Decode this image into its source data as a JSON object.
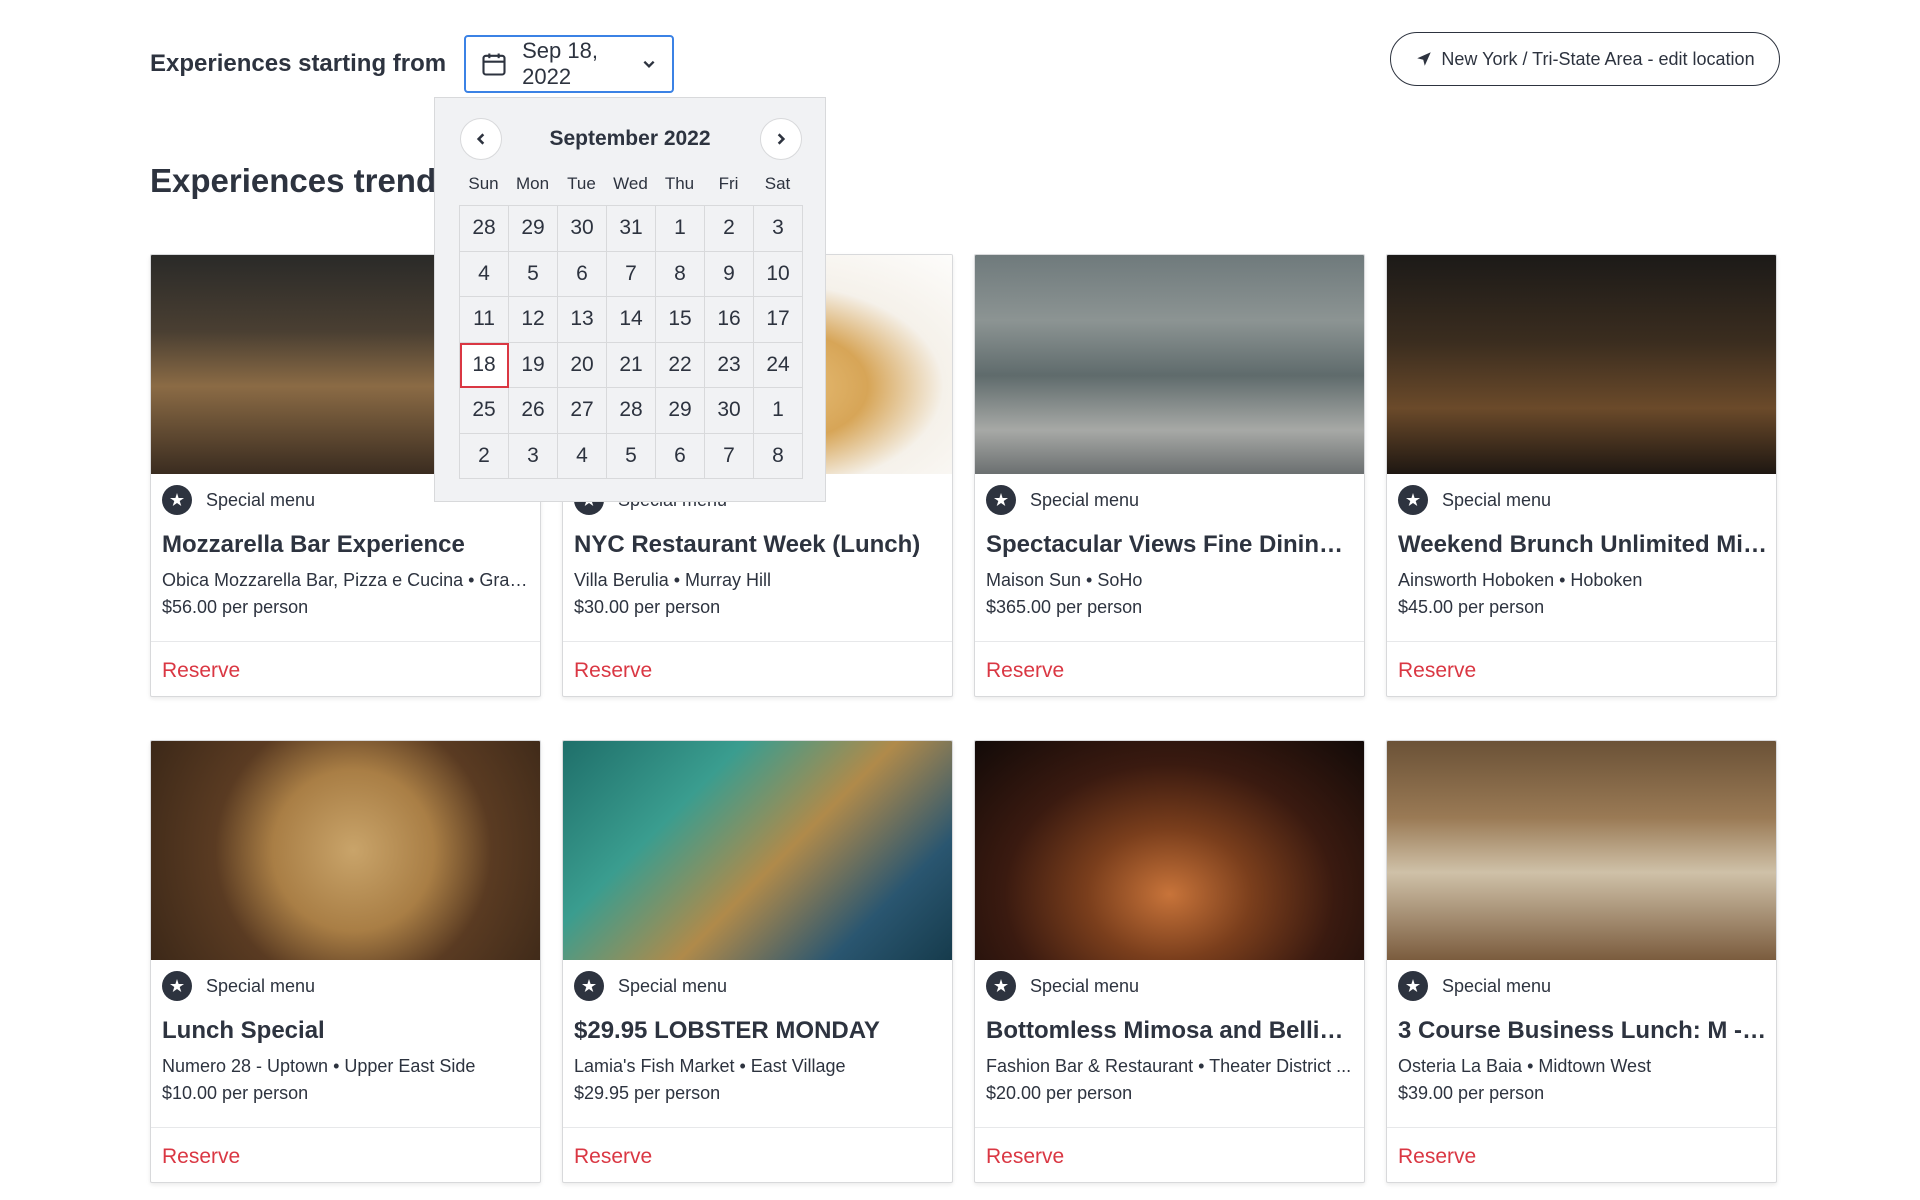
{
  "header": {
    "start_label": "Experiences starting from",
    "selected_date": "Sep 18, 2022",
    "location": "New York / Tri-State Area - edit location"
  },
  "section_title": "Experiences trending in your area",
  "calendar": {
    "month": "September 2022",
    "weekdays": [
      "Sun",
      "Mon",
      "Tue",
      "Wed",
      "Thu",
      "Fri",
      "Sat"
    ],
    "days": [
      "28",
      "29",
      "30",
      "31",
      "1",
      "2",
      "3",
      "4",
      "5",
      "6",
      "7",
      "8",
      "9",
      "10",
      "11",
      "12",
      "13",
      "14",
      "15",
      "16",
      "17",
      "18",
      "19",
      "20",
      "21",
      "22",
      "23",
      "24",
      "25",
      "26",
      "27",
      "28",
      "29",
      "30",
      "1",
      "2",
      "3",
      "4",
      "5",
      "6",
      "7",
      "8"
    ],
    "selected_day": "18"
  },
  "cards": [
    {
      "tag": "Special menu",
      "title": "Mozzarella Bar Experience",
      "venue": "Obica Mozzarella Bar, Pizza e Cucina • Gram...",
      "price": "$56.00 per person",
      "action": "Reserve"
    },
    {
      "tag": "Special menu",
      "title": "NYC Restaurant Week (Lunch)",
      "venue": "Villa Berulia • Murray Hill",
      "price": "$30.00 per person",
      "action": "Reserve"
    },
    {
      "tag": "Special menu",
      "title": "Spectacular Views Fine Dining Sp...",
      "venue": "Maison Sun • SoHo",
      "price": "$365.00 per person",
      "action": "Reserve"
    },
    {
      "tag": "Special menu",
      "title": "Weekend Brunch Unlimited Mim...",
      "venue": "Ainsworth Hoboken • Hoboken",
      "price": "$45.00 per person",
      "action": "Reserve"
    },
    {
      "tag": "Special menu",
      "title": "Lunch Special",
      "venue": "Numero 28 - Uptown • Upper East Side",
      "price": "$10.00 per person",
      "action": "Reserve"
    },
    {
      "tag": "Special menu",
      "title": "$29.95 LOBSTER MONDAY",
      "venue": "Lamia's Fish Market • East Village",
      "price": "$29.95 per person",
      "action": "Reserve"
    },
    {
      "tag": "Special menu",
      "title": "Bottomless Mimosa and Bellini, E...",
      "venue": "Fashion Bar & Restaurant • Theater District ...",
      "price": "$20.00 per person",
      "action": "Reserve"
    },
    {
      "tag": "Special menu",
      "title": "3 Course Business Lunch: M - F O...",
      "venue": "Osteria La Baia • Midtown West",
      "price": "$39.00 per person",
      "action": "Reserve"
    }
  ],
  "colors": {
    "accent_red": "#da3743",
    "focus_blue": "#3b82e5",
    "text": "#2d333f"
  }
}
